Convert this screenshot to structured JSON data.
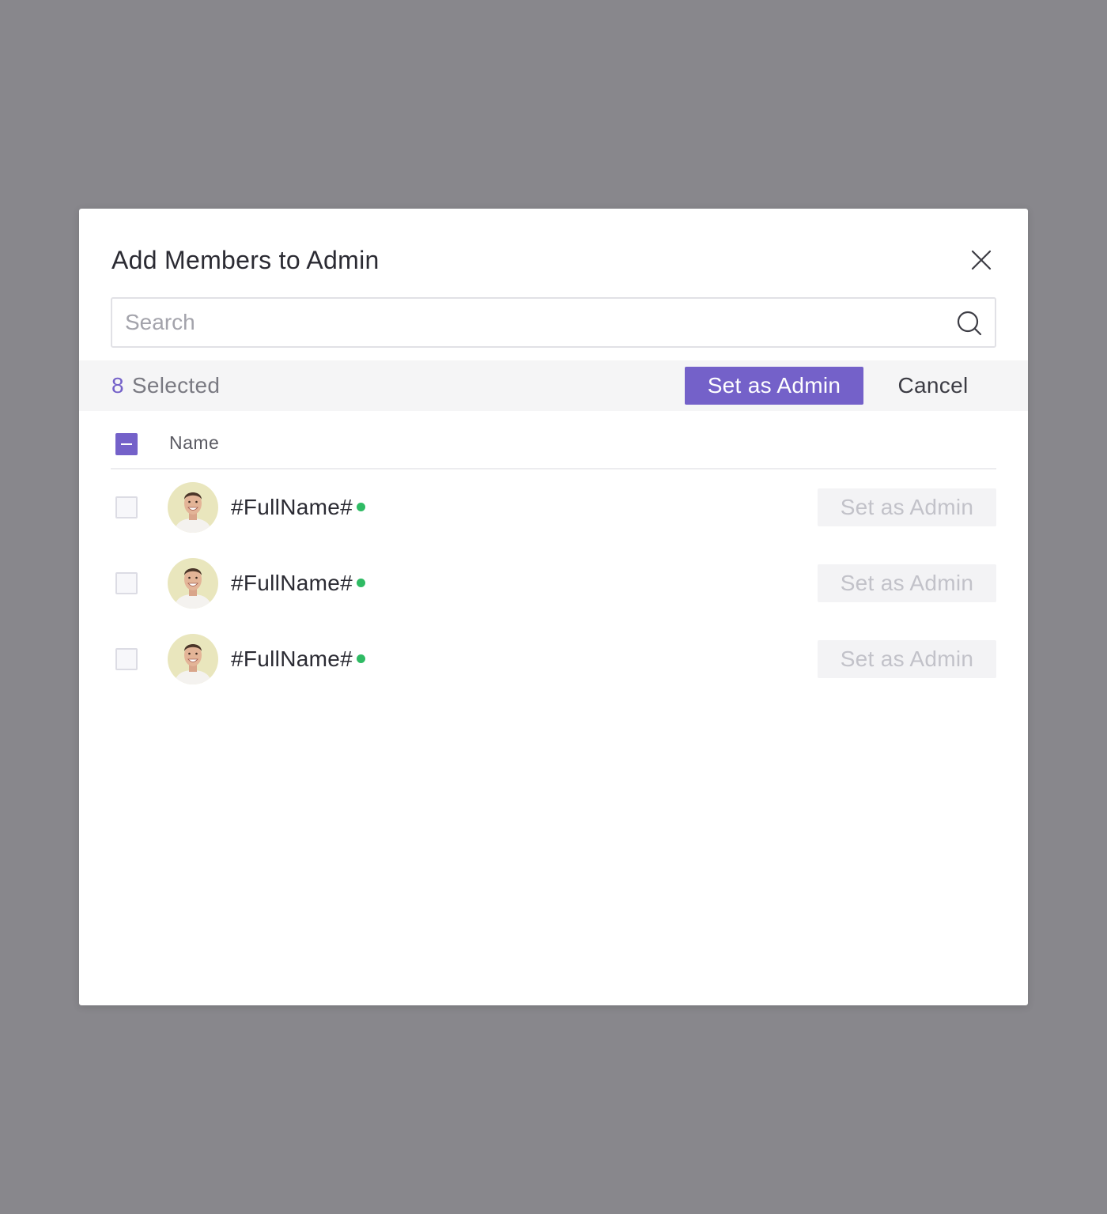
{
  "dialog": {
    "title": "Add Members to Admin"
  },
  "search": {
    "placeholder": "Search",
    "value": ""
  },
  "selection_bar": {
    "count": "8",
    "count_label": "Selected",
    "primary_action": "Set as Admin",
    "cancel_label": "Cancel"
  },
  "table": {
    "header_checkbox_state": "indeterminate",
    "columns": [
      "Name"
    ]
  },
  "members": [
    {
      "name": "#FullName#",
      "status": "online",
      "checked": false,
      "action": "Set as Admin"
    },
    {
      "name": "#FullName#",
      "status": "online",
      "checked": false,
      "action": "Set as Admin"
    },
    {
      "name": "#FullName#",
      "status": "online",
      "checked": false,
      "action": "Set as Admin"
    }
  ],
  "colors": {
    "accent": "#7461c9",
    "online": "#2fbb64",
    "backdrop": "#88878c",
    "disabled_text": "#c2c2c9"
  },
  "icons": {
    "close": "close-icon",
    "search": "search-icon",
    "status": "online-status-icon"
  }
}
